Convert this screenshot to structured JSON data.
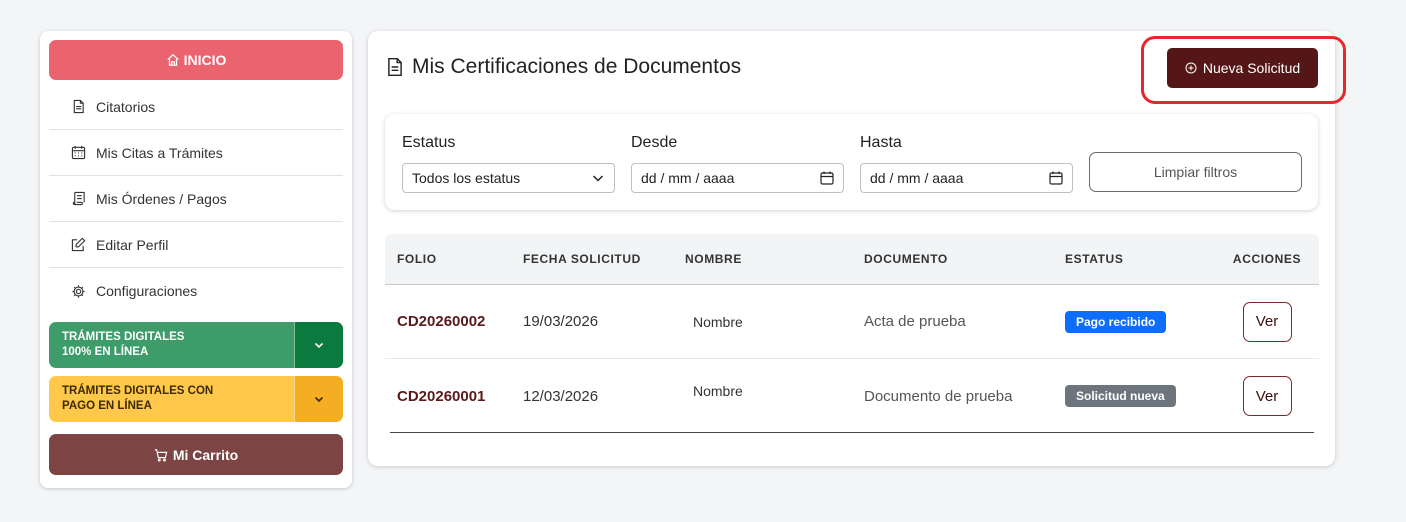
{
  "sidebar": {
    "inicio_label": "INICIO",
    "items": [
      {
        "label": "Citatorios",
        "icon": "document-icon"
      },
      {
        "label": "Mis Citas a Trámites",
        "icon": "calendar-icon"
      },
      {
        "label": "Mis Órdenes / Pagos",
        "icon": "receipt-icon"
      },
      {
        "label": "Editar Perfil",
        "icon": "edit-icon"
      },
      {
        "label": "Configuraciones",
        "icon": "gear-icon"
      }
    ],
    "tramites_online": {
      "line1": "TRÁMITES DIGITALES",
      "line2": "100% EN LÍNEA"
    },
    "tramites_pago": {
      "line1": "TRÁMITES DIGITALES CON",
      "line2": "PAGO EN LÍNEA"
    },
    "carrito_label": "Mi Carrito"
  },
  "main": {
    "title": "Mis Certificaciones de Documentos",
    "nueva_label": "Nueva Solicitud",
    "filters": {
      "estatus_label": "Estatus",
      "estatus_value": "Todos los estatus",
      "desde_label": "Desde",
      "desde_value": "dd / mm / aaaa",
      "hasta_label": "Hasta",
      "hasta_value": "dd / mm / aaaa",
      "limpiar_label": "Limpiar filtros"
    },
    "table": {
      "headers": [
        "FOLIO",
        "FECHA SOLICITUD",
        "NOMBRE",
        "DOCUMENTO",
        "ESTATUS",
        "ACCIONES"
      ],
      "rows": [
        {
          "folio": "CD20260002",
          "fecha": "19/03/2026",
          "nombre": "Nombre",
          "documento": "Acta de prueba",
          "estatus": "Pago recibido",
          "accion": "Ver"
        },
        {
          "folio": "CD20260001",
          "fecha": "12/03/2026",
          "nombre": "Nombre",
          "documento": "Documento de prueba",
          "estatus": "Solicitud nueva",
          "accion": "Ver"
        }
      ]
    }
  },
  "colors": {
    "inicio": "#ec6370",
    "nueva_button": "#541616",
    "highlight": "#e8262b",
    "badge_pago_recibido": "#0d6efd",
    "badge_solicitud_nueva": "#6c757d",
    "carrito": "#7c4442"
  }
}
